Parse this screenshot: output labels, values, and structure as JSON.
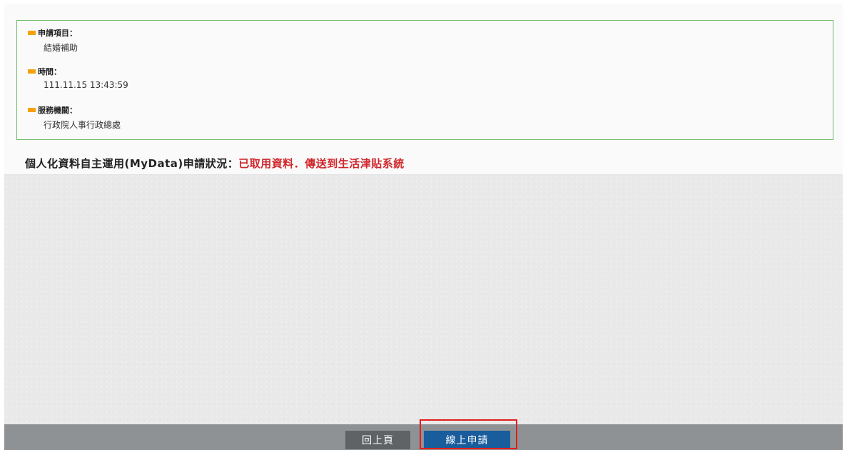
{
  "colors": {
    "marker": "#f5a10c",
    "status_value": "#d0262b",
    "box_border": "#6fb86f",
    "highlight": "#e31c1c",
    "apply_button": "#1a5d9c",
    "back_button": "#5f6366"
  },
  "fields": [
    {
      "label": "申請項目：",
      "value": "結婚補助"
    },
    {
      "label": "時間：",
      "value": "111.11.15 13:43:59"
    },
    {
      "label": "服務機關：",
      "value": "行政院人事行政總處"
    }
  ],
  "status": {
    "label": "個人化資料自主運用(MyData)申請狀況：",
    "value": "已取用資料．傳送到生活津貼系統"
  },
  "buttons": {
    "back_label": "回上頁",
    "apply_label": "線上申請"
  }
}
